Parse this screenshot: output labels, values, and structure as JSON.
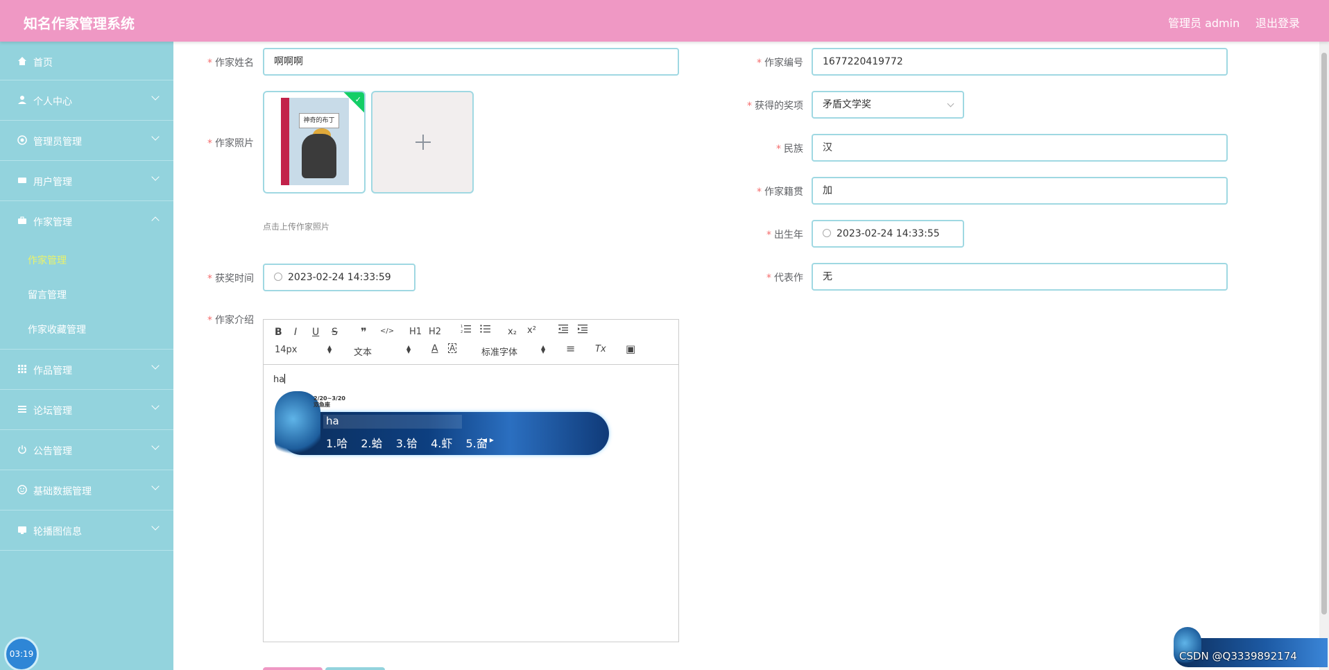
{
  "header": {
    "title": "知名作家管理系统",
    "admin": "管理员 admin",
    "logout": "退出登录"
  },
  "sidebar": {
    "items": [
      {
        "label": "首页",
        "icon": "home-icon"
      },
      {
        "label": "个人中心",
        "icon": "user-icon"
      },
      {
        "label": "管理员管理",
        "icon": "admin-icon"
      },
      {
        "label": "用户管理",
        "icon": "users-icon"
      },
      {
        "label": "作家管理",
        "icon": "briefcase-icon"
      }
    ],
    "sub_items": [
      {
        "label": "作家管理",
        "active": true
      },
      {
        "label": "留言管理"
      },
      {
        "label": "作家收藏管理"
      }
    ],
    "items2": [
      {
        "label": "作品管理",
        "icon": "grid-icon"
      },
      {
        "label": "论坛管理",
        "icon": "list-icon"
      },
      {
        "label": "公告管理",
        "icon": "power-icon"
      },
      {
        "label": "基础数据管理",
        "icon": "smile-icon"
      },
      {
        "label": "轮播图信息",
        "icon": "image-icon"
      }
    ],
    "timer": "03:19"
  },
  "form": {
    "name_label": "作家姓名",
    "name_value": "啊啊啊",
    "photo_label": "作家照片",
    "photo_hint": "点击上传作家照片",
    "book_title": "神奇的布丁",
    "award_time_label": "获奖时间",
    "award_time_value": "2023-02-24 14:33:59",
    "intro_label": "作家介绍",
    "number_label": "作家编号",
    "number_value": "1677220419772",
    "award_label": "获得的奖项",
    "award_value": "矛盾文学奖",
    "ethnic_label": "民族",
    "ethnic_value": "汉",
    "origin_label": "作家籍贯",
    "origin_value": "加",
    "birth_label": "出生年",
    "birth_value": "2023-02-24 14:33:55",
    "works_label": "代表作",
    "works_value": "无"
  },
  "editor": {
    "font_size": "14px",
    "text_type": "文本",
    "font_family": "标准字体",
    "content": "ha",
    "toolbar_glyphs": {
      "bold": "B",
      "italic": "I",
      "underline": "U",
      "strike": "S",
      "quote": "❞",
      "code": "</>",
      "h1": "H1",
      "h2": "H2",
      "sub": "x₂",
      "sup": "x²",
      "color": "A",
      "bg": "A",
      "align": "≡",
      "clear": "Tx",
      "img": "▣"
    }
  },
  "ime": {
    "input": "ha",
    "date": "2/20~3/20",
    "sign": "双鱼座",
    "candidates": [
      "1.哈",
      "2.蛤",
      "3.铪",
      "4.虾",
      "5.奤"
    ]
  },
  "watermark": "CSDN @Q3339892174"
}
